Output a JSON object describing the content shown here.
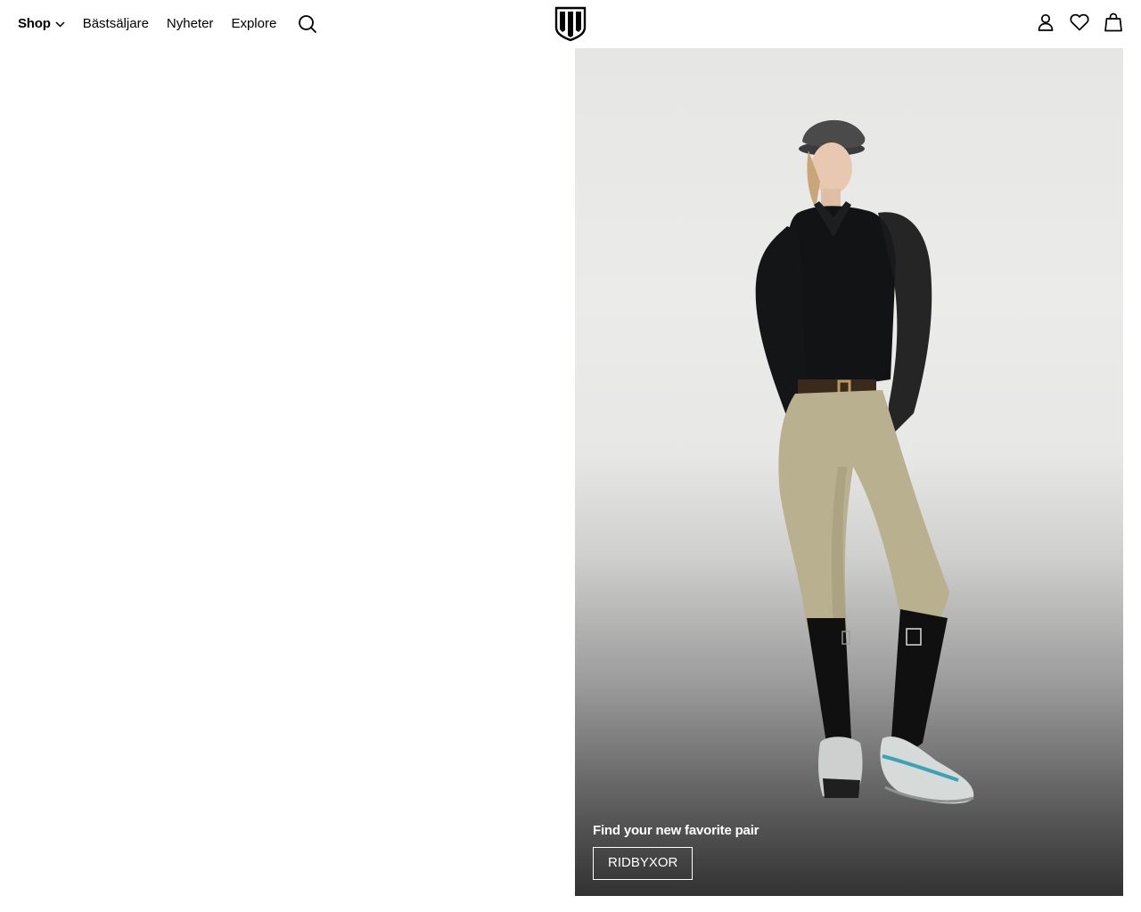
{
  "nav": {
    "shop_label": "Shop",
    "bestsellers_label": "Bästsäljare",
    "news_label": "Nyheter",
    "explore_label": "Explore"
  },
  "icons": {
    "search": "search-icon",
    "logo": "brand-shield-logo",
    "account": "user-icon",
    "wishlist": "heart-icon",
    "cart": "shopping-bag-icon"
  },
  "hero": {
    "heading": "Find your new favorite pair",
    "cta_label": "RIDBYXOR"
  },
  "colors": {
    "text": "#000000",
    "background": "#ffffff",
    "hero_text": "#ffffff"
  }
}
